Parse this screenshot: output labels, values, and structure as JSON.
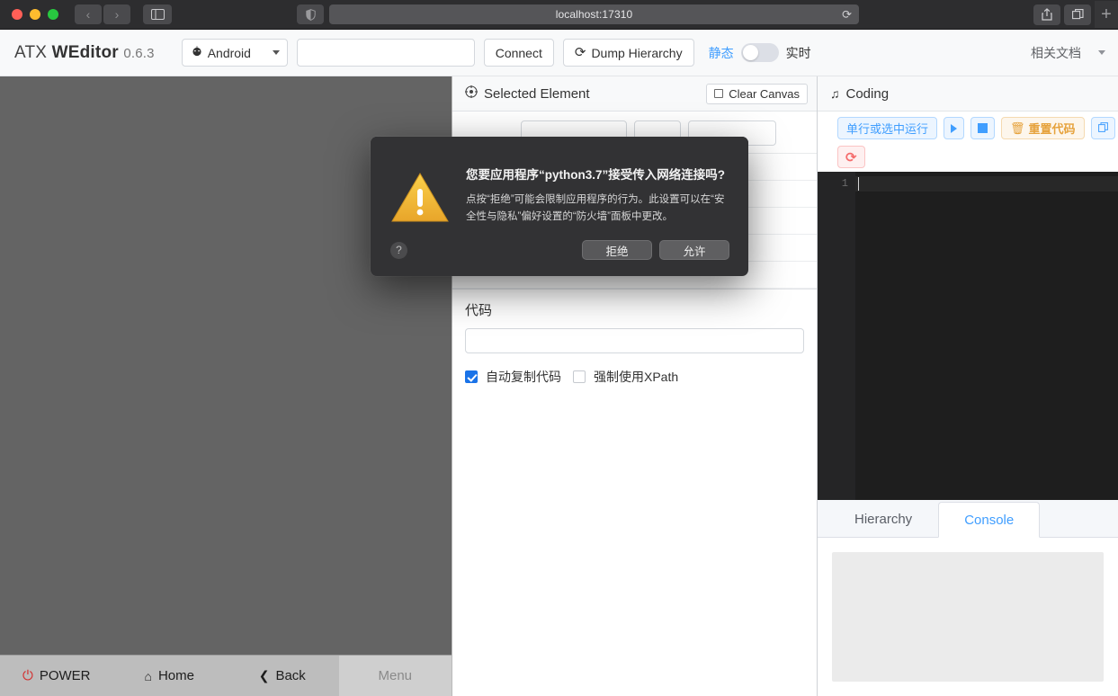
{
  "browser": {
    "url": "localhost:17310",
    "reload_icon": "reload-icon",
    "back_icon": "chevron-left-icon",
    "forward_icon": "chevron-right-icon",
    "sidebar_icon": "sidebar-toggle-icon",
    "shield_icon": "shield-icon",
    "share_icon": "share-icon",
    "tabs_icon": "tab-overview-icon",
    "new_tab_icon": "plus-icon"
  },
  "toolbar": {
    "brand_prefix": "ATX ",
    "brand_bold": "WEditor",
    "version": "0.6.3",
    "platform_select": "Android",
    "platform_icon": "android-icon",
    "serial_placeholder": "",
    "serial_value": "",
    "connect_label": "Connect",
    "dump_label": "Dump Hierarchy",
    "dump_icon": "refresh-icon",
    "toggle_left_label": "静态",
    "toggle_right_label": "实时",
    "toggle_state": "off",
    "docs_label": "相关文档",
    "docs_caret": "chevron-down-icon"
  },
  "device": {
    "nav": [
      {
        "label": "POWER",
        "icon": "power-icon",
        "disabled": false
      },
      {
        "label": "Home",
        "icon": "home-icon",
        "disabled": false
      },
      {
        "label": "Back",
        "icon": "chevron-left-icon",
        "disabled": false
      },
      {
        "label": "Menu",
        "icon": "menu-icon",
        "disabled": true
      }
    ]
  },
  "inspector": {
    "title": "Selected Element",
    "title_icon": "target-icon",
    "clear_canvas_label": "Clear Canvas",
    "properties": [
      {
        "key": "",
        "value": ""
      },
      {
        "key": "",
        "value": ""
      },
      {
        "key": "",
        "value": ""
      },
      {
        "key": "",
        "value": ""
      },
      {
        "key": "",
        "value": ""
      }
    ],
    "code_label": "代码",
    "code_value": "",
    "auto_copy_label": "自动复制代码",
    "auto_copy_checked": true,
    "force_xpath_label": "强制使用XPath",
    "force_xpath_checked": false
  },
  "coding": {
    "title": "Coding",
    "title_icon": "music-note-icon",
    "buttons": [
      {
        "label": "单行或选中运行",
        "style": "blue",
        "icon": ""
      },
      {
        "label": "",
        "style": "blue-sq",
        "icon": "play-icon"
      },
      {
        "label": "",
        "style": "blue-solid",
        "icon": "stop-icon"
      },
      {
        "label": "重置代码",
        "style": "orange",
        "icon": "trash-icon"
      },
      {
        "label": "",
        "style": "blue-sq",
        "icon": "copy-icon"
      },
      {
        "label": "",
        "style": "red",
        "icon": "restart-icon"
      }
    ],
    "editor": {
      "line_numbers": [
        "1"
      ],
      "lines": [
        ""
      ]
    },
    "tabs": [
      {
        "label": "Hierarchy",
        "active": false
      },
      {
        "label": "Console",
        "active": true
      }
    ],
    "console_output": ""
  },
  "dialog": {
    "icon": "warning-triangle-icon",
    "title": "您要应用程序“python3.7”接受传入网络连接吗?",
    "message": "点按“拒绝”可能会限制应用程序的行为。此设置可以在“安全性与隐私”偏好设置的“防火墙”面板中更改。",
    "help_label": "?",
    "deny_label": "拒绝",
    "allow_label": "允许"
  },
  "colors": {
    "accent_blue": "#409eff",
    "warning_orange": "#e6a23c",
    "danger_red": "#f56c6c",
    "power_red": "#d32f2f"
  }
}
